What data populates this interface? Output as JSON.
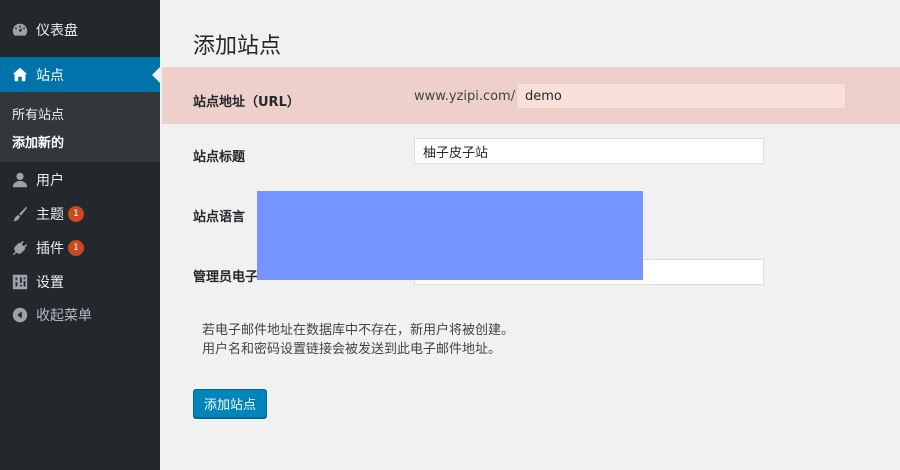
{
  "sidebar": {
    "items": [
      {
        "label": "仪表盘",
        "icon": "dashboard-icon"
      },
      {
        "label": "站点",
        "icon": "sites-icon",
        "active": true
      },
      {
        "label": "用户",
        "icon": "user-icon"
      },
      {
        "label": "主题",
        "icon": "brush-icon",
        "badge": "1"
      },
      {
        "label": "插件",
        "icon": "plugin-icon",
        "badge": "1"
      },
      {
        "label": "设置",
        "icon": "settings-icon"
      },
      {
        "label": "收起菜单",
        "icon": "collapse-icon"
      }
    ],
    "submenu": [
      {
        "label": "所有站点"
      },
      {
        "label": "添加新的",
        "current": true
      }
    ]
  },
  "main": {
    "page_title": "添加站点",
    "fields": {
      "site_address_label": "站点地址（URL）",
      "url_prefix": "www.yzipi.com/",
      "url_value": "demo",
      "site_title_label": "站点标题",
      "site_title_value": "柚子皮子站",
      "site_language_label": "站点语言",
      "admin_email_label": "管理员电子"
    },
    "help_lines": [
      "若电子邮件地址在数据库中不存在，新用户将被创建。",
      "用户名和密码设置链接会被发送到此电子邮件地址。"
    ],
    "submit_label": "添加站点"
  },
  "colors": {
    "sidebar_bg": "#23282d",
    "active_bg": "#0073aa",
    "highlight_row": "#ecd0c9",
    "badge": "#ca4a1f",
    "overlay": "#7594ff",
    "primary_button": "#0085ba"
  }
}
